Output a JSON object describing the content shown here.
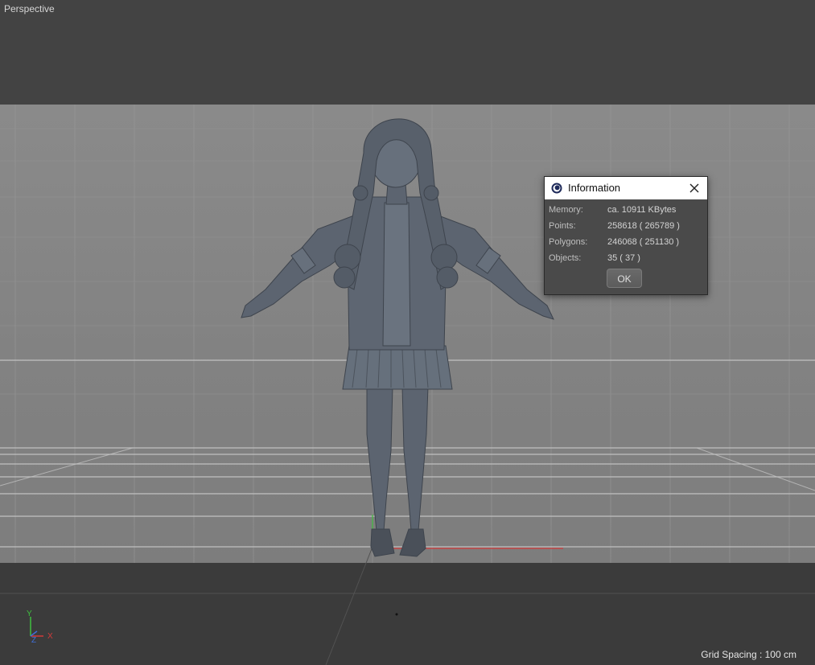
{
  "viewport": {
    "label": "Perspective",
    "grid_spacing": "Grid Spacing : 100 cm",
    "axis_labels": {
      "y": "Y",
      "z": "Z",
      "x": "X"
    }
  },
  "model_icon": "character-model-figure",
  "dialog": {
    "title": "Information",
    "app_icon": "cinema4d-logo-icon",
    "close_icon": "close-icon",
    "rows": [
      {
        "label": "Memory:",
        "value": "ca. 10911 KBytes"
      },
      {
        "label": "Points:",
        "value": "258618 ( 265789 )"
      },
      {
        "label": "Polygons:",
        "value": "246068 ( 251130 )"
      },
      {
        "label": "Objects:",
        "value": "35 ( 37 )"
      }
    ],
    "ok_label": "OK"
  },
  "colors": {
    "axis_x": "#d23a3a",
    "axis_y": "#3fbf3f",
    "axis_z": "#3f6fd8"
  }
}
